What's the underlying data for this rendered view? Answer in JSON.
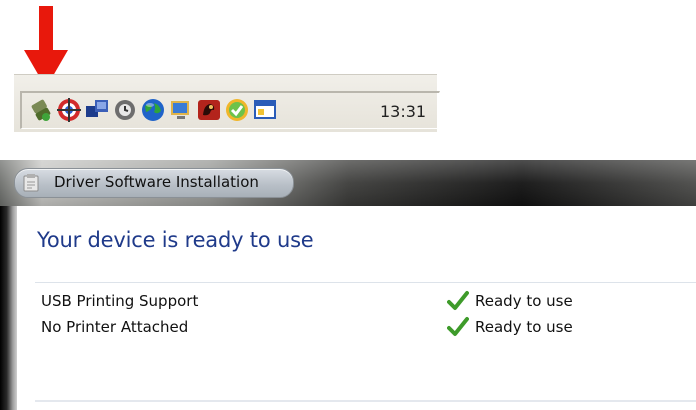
{
  "taskbar": {
    "clock": "13:31",
    "icons": [
      "safely-remove-hardware-icon",
      "network-target-icon",
      "monitors-icon",
      "clock-sync-icon",
      "globe-icon",
      "display-icon",
      "red-app-icon",
      "security-check-icon",
      "window-icon"
    ]
  },
  "annotation": {
    "arrow_color": "#e8180c",
    "arrow_icon": "red-down-arrow-icon"
  },
  "dialog": {
    "title": "Driver Software Installation",
    "heading": "Your device is ready to use",
    "heading_color": "#1f3a8a",
    "devices": [
      {
        "name": "USB Printing Support",
        "status": "Ready to use"
      },
      {
        "name": "No Printer Attached",
        "status": "Ready to use"
      }
    ],
    "status_icon": "green-check-icon",
    "status_color": "#3e9b2a"
  }
}
